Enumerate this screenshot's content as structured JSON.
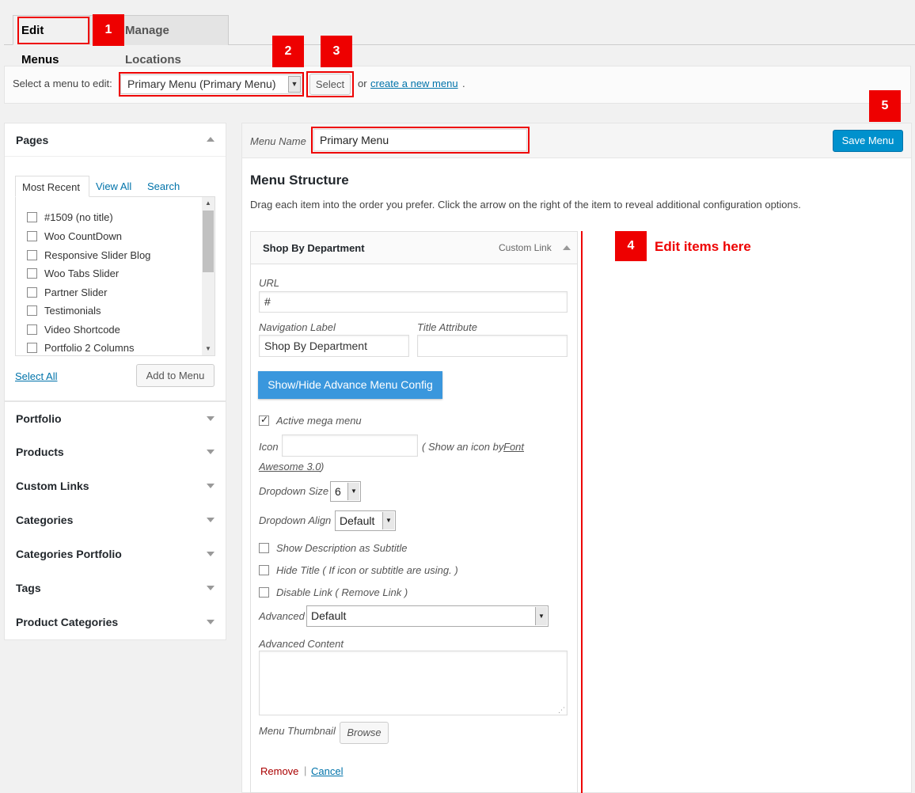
{
  "tabs": {
    "edit_menus": "Edit Menus",
    "manage_locations": "Manage Locations"
  },
  "markers": [
    "1",
    "2",
    "3",
    "4",
    "5"
  ],
  "annotation": {
    "edit_items": "Edit items here"
  },
  "select_bar": {
    "label": "Select a menu to edit:",
    "selected_menu": "Primary Menu (Primary Menu)",
    "select_button": "Select",
    "or_text": "or",
    "create_link": "create a new menu",
    "period": "."
  },
  "sidebar": {
    "pages": {
      "title": "Pages",
      "tabs": [
        "Most Recent",
        "View All",
        "Search"
      ],
      "items": [
        "#1509 (no title)",
        "Woo CountDown",
        "Responsive Slider Blog",
        "Woo Tabs Slider",
        "Partner Slider",
        "Testimonials",
        "Video Shortcode",
        "Portfolio 2 Columns"
      ],
      "select_all": "Select All",
      "add_to_menu": "Add to Menu"
    },
    "sections": [
      "Portfolio",
      "Products",
      "Custom Links",
      "Categories",
      "Categories Portfolio",
      "Tags",
      "Product Categories"
    ]
  },
  "menu_editor": {
    "menu_name_label": "Menu Name",
    "menu_name_value": "Primary Menu",
    "save_button": "Save Menu",
    "structure_title": "Menu Structure",
    "structure_desc": "Drag each item into the order you prefer. Click the arrow on the right of the item to reveal additional configuration options.",
    "item": {
      "title": "Shop By Department",
      "type": "Custom Link",
      "url_label": "URL",
      "url_value": "#",
      "nav_label": "Navigation Label",
      "nav_value": "Shop By Department",
      "title_attr_label": "Title Attribute",
      "title_attr_value": "",
      "advance_button": "Show/Hide Advance Menu Config",
      "active_mega": "Active mega menu",
      "icon_label": "Icon",
      "icon_hint_pre": "( Show an icon by",
      "icon_hint_link1": "Font",
      "icon_hint_link2": "Awesome 3.0",
      "icon_hint_post": ")",
      "dropdown_size_label": "Dropdown Size",
      "dropdown_size_value": "6",
      "dropdown_align_label": "Dropdown Align",
      "dropdown_align_value": "Default",
      "show_desc": "Show Description as Subtitle",
      "hide_title": "Hide Title ( If icon or subtitle are using. )",
      "disable_link": "Disable Link ( Remove Link )",
      "advanced_label": "Advanced",
      "advanced_value": "Default",
      "advanced_content_label": "Advanced Content",
      "thumbnail_label": "Menu Thumbnail",
      "browse_button": "Browse",
      "remove_link": "Remove",
      "separator": "|",
      "cancel_link": "Cancel"
    }
  },
  "colors": {
    "accent": "#0073aa",
    "primary_button": "#0091cd",
    "advance_button": "#3a97dd",
    "marker_red": "#ee0000",
    "remove_red": "#a00"
  }
}
